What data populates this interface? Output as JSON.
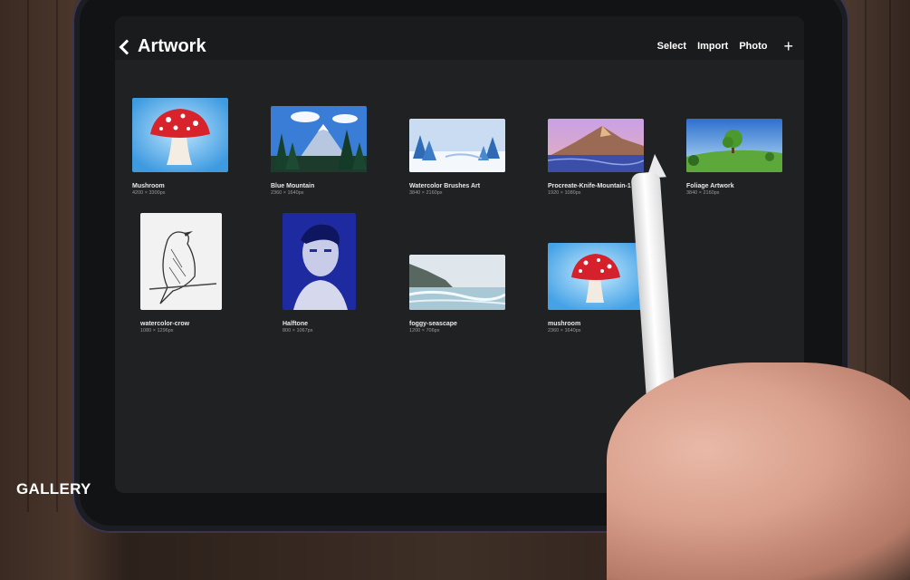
{
  "header": {
    "title": "Artwork",
    "actions": {
      "select": "Select",
      "import": "Import",
      "photo": "Photo"
    }
  },
  "artworks": [
    {
      "name": "Mushroom",
      "size": "4200 × 3300px"
    },
    {
      "name": "Blue Mountain",
      "size": "2360 × 1640px"
    },
    {
      "name": "Watercolor Brushes Art",
      "size": "3840 × 2160px"
    },
    {
      "name": "Procreate-Knife-Mountain-1",
      "size": "1920 × 1080px"
    },
    {
      "name": "Foliage Artwork",
      "size": "3840 × 2160px"
    },
    {
      "name": "watercolor-crow",
      "size": "1080 × 1296px"
    },
    {
      "name": "Halftone",
      "size": "800 × 1067px"
    },
    {
      "name": "foggy-seascape",
      "size": "1200 × 706px"
    },
    {
      "name": "mushroom",
      "size": "2360 × 1640px"
    }
  ],
  "watermark": "GALLERY"
}
